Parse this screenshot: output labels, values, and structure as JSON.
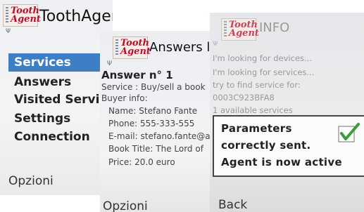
{
  "screen1": {
    "logo": [
      "Tooth",
      "Agent"
    ],
    "title": "ToothAgent",
    "menu": [
      "Services",
      "Answers",
      "Visited Servi",
      "Settings",
      "Connection"
    ],
    "selected_index": 0,
    "softkey_left": "Opzioni"
  },
  "screen2": {
    "logo": [
      "Tooth",
      "Agent"
    ],
    "title": "Answers li",
    "answer_heading": "Answer n° 1",
    "service_line": "Service : Buy/sell a book",
    "buyer_info": "Buyer info:",
    "fields": [
      "Name: Stefano Fante",
      "Phone: 555-333-555",
      "E-mail: stefano.fante@a",
      "Book Title: The Lord of",
      "Price: 20.0 euro"
    ],
    "softkey_left": "Opzioni"
  },
  "screen3": {
    "logo": [
      "Tooth",
      "Agent"
    ],
    "title": "INFO",
    "log": [
      "I'm looking for devices...",
      "I'm looking for services...",
      " try to find service for:",
      "0003C923BFA8",
      "1 available services"
    ],
    "popup": [
      "Parameters",
      "correctly sent.",
      "Agent is now active"
    ],
    "softkey_left": "Back"
  },
  "colors": {
    "selection": "#3d7ec4",
    "logo_red": "#b3122c",
    "check_green": "#3c9a3a"
  }
}
